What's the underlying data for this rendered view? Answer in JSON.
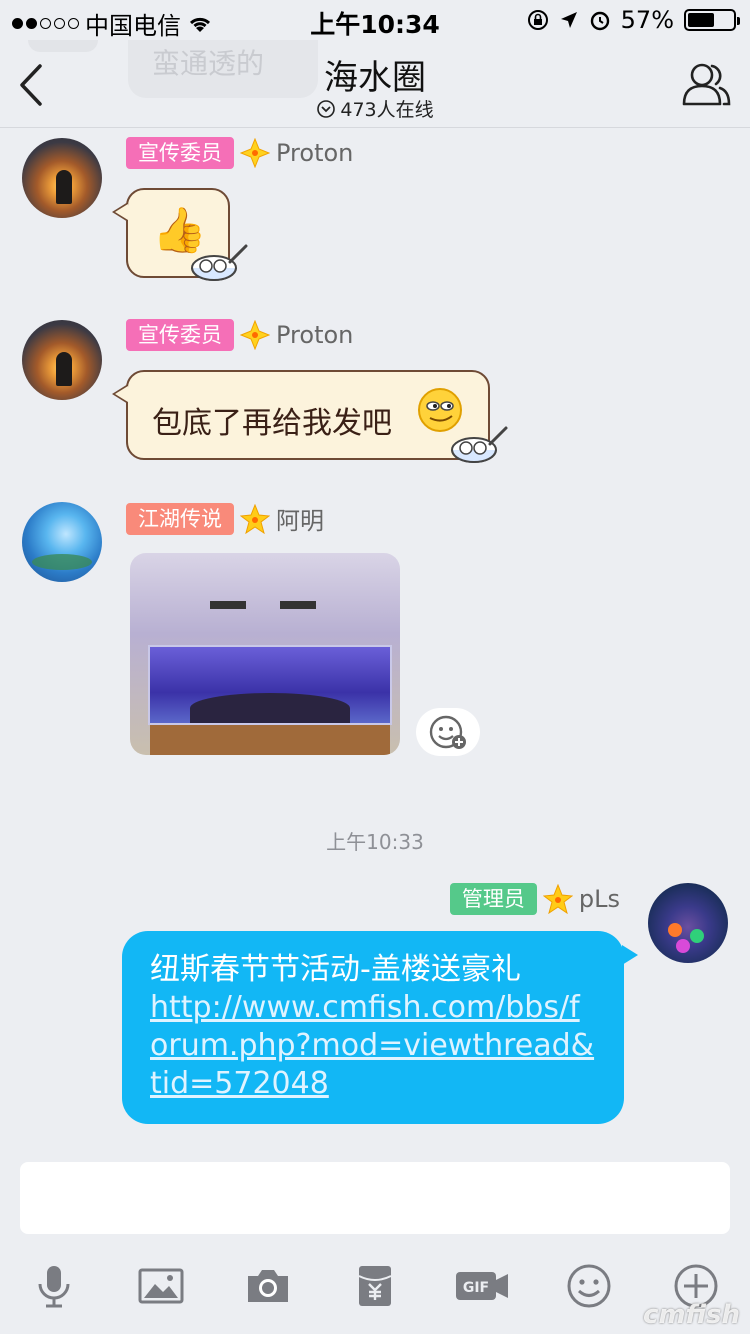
{
  "status_bar": {
    "carrier": "中国电信",
    "time": "上午10:34",
    "battery": "57%"
  },
  "nav": {
    "ghost_text": "蛮通透的",
    "title": "海水圈",
    "online": "473人在线"
  },
  "messages": [
    {
      "badge": "宣传委员",
      "badge_color": "#f56fb7",
      "name": "Proton",
      "content": "👍"
    },
    {
      "badge": "宣传委员",
      "badge_color": "#f56fb7",
      "name": "Proton",
      "content": "包底了再给我发吧"
    },
    {
      "badge": "江湖传说",
      "badge_color": "#f98a7a",
      "name": "阿明",
      "content_type": "image"
    },
    {
      "badge": "管理员",
      "badge_color": "#55c98a",
      "name": "pLs",
      "title": "纽斯春节节活动-盖楼送豪礼",
      "link": "http://www.cmfish.com/bbs/forum.php?mod=viewthread&tid=572048"
    }
  ],
  "timestamp": "上午10:33",
  "toolbar": [
    "mic-icon",
    "image-icon",
    "camera-icon",
    "red-envelope-icon",
    "gif-icon",
    "emoji-icon",
    "plus-icon"
  ],
  "watermark": "cmfish"
}
